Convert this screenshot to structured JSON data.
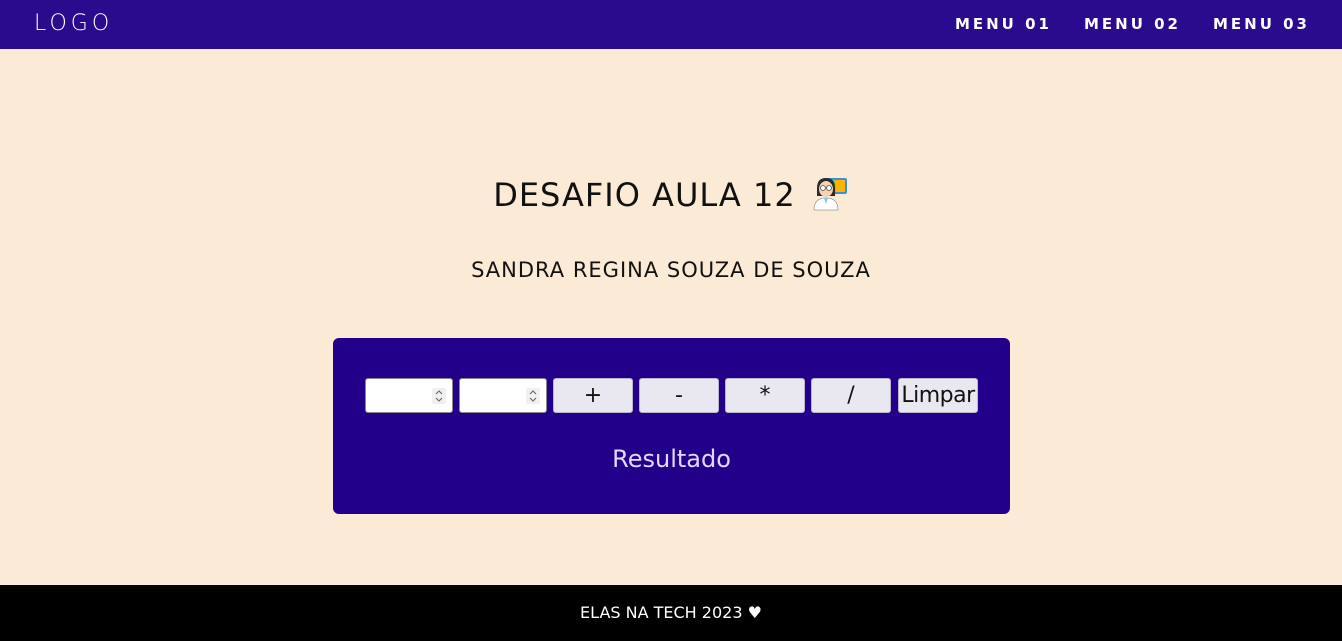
{
  "header": {
    "logo": "LOGO",
    "menu": [
      "MENU 01",
      "MENU 02",
      "MENU 03"
    ]
  },
  "main": {
    "title": "DESAFIO AULA 12",
    "subtitle": "SANDRA REGINA SOUZA DE SOUZA",
    "title_icon": "woman-scientist-icon"
  },
  "calculator": {
    "input1_value": "",
    "input2_value": "",
    "operators": [
      "+",
      "-",
      "*",
      "/"
    ],
    "clear_label": "Limpar",
    "result_label": "Resultado"
  },
  "footer": {
    "text": "ELAS NA TECH 2023 ♥"
  },
  "colors": {
    "header_bg": "#2a0a8d",
    "page_bg": "#fbebd6",
    "calc_bg": "#22008a",
    "footer_bg": "#000000"
  }
}
